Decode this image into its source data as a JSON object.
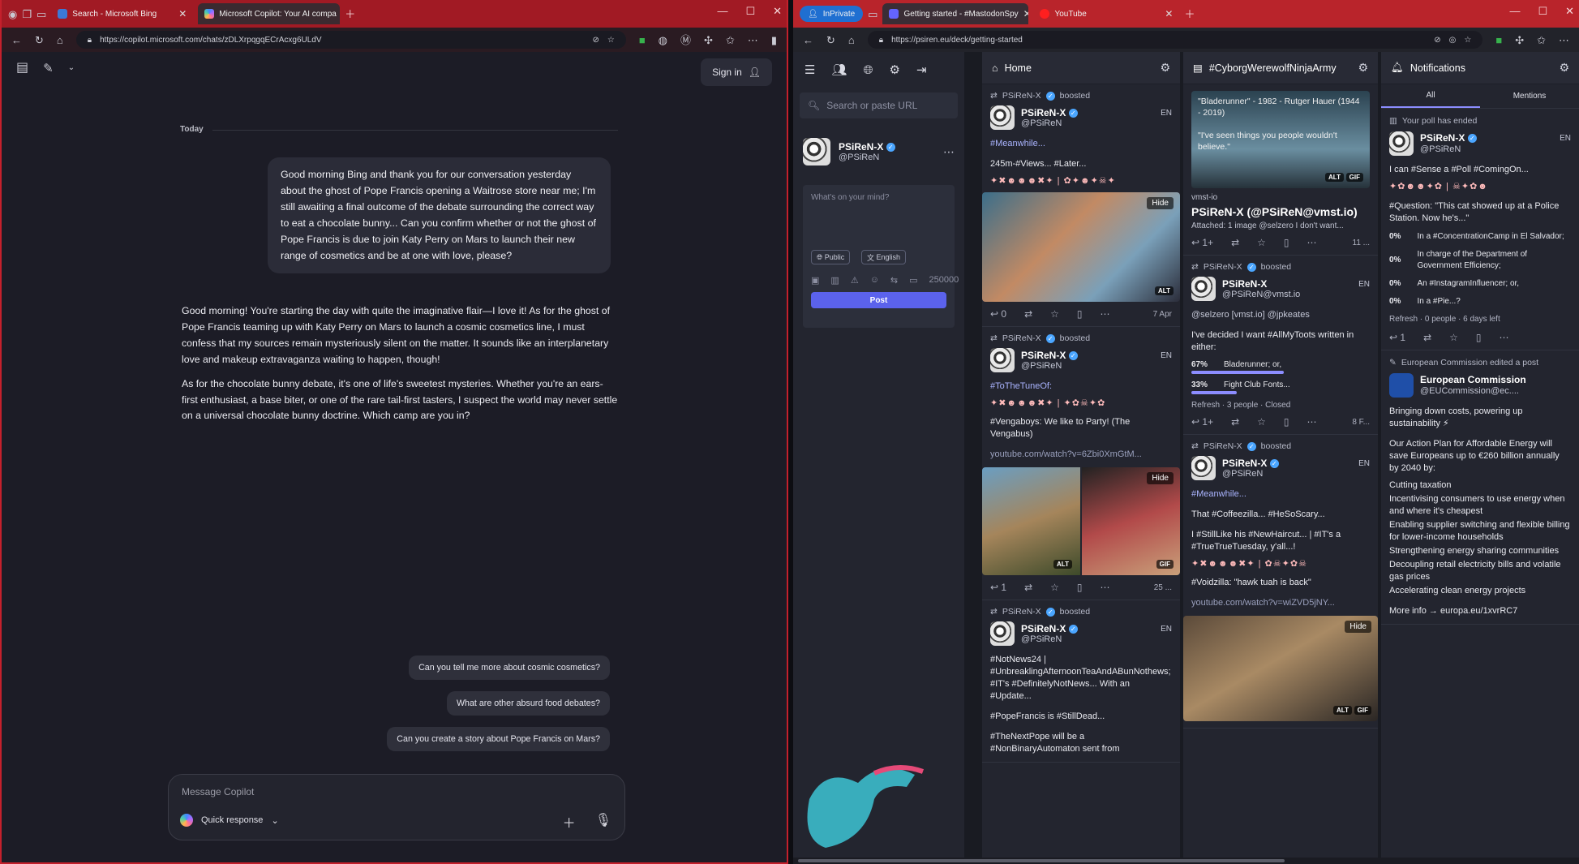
{
  "left_browser": {
    "tabs": [
      {
        "label": "Search - Microsoft Bing",
        "active": false
      },
      {
        "label": "Microsoft Copilot: Your AI compa",
        "active": true
      }
    ],
    "url": "https://copilot.microsoft.com/chats/zDLXrpqgqECrAcxg6ULdV"
  },
  "copilot": {
    "sign_in": "Sign in",
    "today_label": "Today",
    "user_message": "Good morning Bing and thank you for our conversation yesterday about the ghost of Pope Francis opening a Waitrose store near me; I'm still awaiting a final outcome of the debate surrounding the correct way to eat a chocolate bunny... Can you confirm whether or not the ghost of Pope Francis is due to join Katy Perry on Mars to launch their new range of cosmetics and be at one with love, please?",
    "ai_paragraphs": [
      "Good morning! You're starting the day with quite the imaginative flair—I love it! As for the ghost of Pope Francis teaming up with Katy Perry on Mars to launch a cosmic cosmetics line, I must confess that my sources remain mysteriously silent on the matter. It sounds like an interplanetary love and makeup extravaganza waiting to happen, though!",
      "As for the chocolate bunny debate, it's one of life's sweetest mysteries. Whether you're an ears-first enthusiast, a base biter, or one of the rare tail-first tasters, I suspect the world may never settle on a universal chocolate bunny doctrine. Which camp are you in?"
    ],
    "suggestions": [
      "Can you tell me more about cosmic cosmetics?",
      "What are other absurd food debates?",
      "Can you create a story about Pope Francis on Mars?"
    ],
    "composer_placeholder": "Message Copilot",
    "quick_response": "Quick response"
  },
  "right_browser": {
    "inprivate": "InPrivate",
    "tabs": [
      {
        "label": "Getting started - #MastodonSpy",
        "active": true
      },
      {
        "label": "YouTube",
        "active": false
      }
    ],
    "url": "https://psiren.eu/deck/getting-started"
  },
  "mastodon": {
    "search_placeholder": "Search or paste URL",
    "me": {
      "name": "PSiReN-X",
      "handle": "@PSiReN"
    },
    "compose": {
      "placeholder": "What's on your mind?",
      "visibility": "Public",
      "language": "English",
      "chars": "250000",
      "post": "Post"
    },
    "home": {
      "title": "Home",
      "statuses": [
        {
          "booster": "PSiReN-X",
          "boosted": "boosted",
          "name": "PSiReN-X",
          "handle": "@PSiReN",
          "lang": "EN",
          "text": "#Meanwhile...",
          "text2": "245m-#Views... #Later...",
          "replies": "0",
          "date": "7 Apr"
        },
        {
          "booster": "PSiReN-X",
          "boosted": "boosted",
          "name": "PSiReN-X",
          "handle": "@PSiReN",
          "lang": "EN",
          "text": "#ToTheTuneOf:",
          "text2": "#Vengaboys: We like to Party! (The Vengabus)",
          "link": "youtube.com/watch?v=6Zbi0XmGtM...",
          "replies": "1",
          "date": "25 ..."
        },
        {
          "booster": "PSiReN-X",
          "boosted": "boosted",
          "name": "PSiReN-X",
          "handle": "@PSiReN",
          "lang": "EN",
          "text": "#NotNews24 | #UnbreaklingAfternoonTeaAndABunNothews; #IT's #DefinitelyNotNews... With an #Update...",
          "text2": "#PopeFrancis is #StillDead...",
          "text3": "#TheNextPope will be a #NonBinaryAutomaton sent from"
        }
      ]
    },
    "hashtag": {
      "title": "#CyborgWerewolfNinjaArmy",
      "card_quote": "\"Bladerunner\" - 1982 - Rutger Hauer (1944 - 2019)\n\n\"I've seen things you people wouldn't believe.\"",
      "card_host": "vmst-io",
      "card_title": "PSiReN-X (@PSiReN@vmst.io)",
      "card_desc": "Attached: 1 image @selzero I don't want...",
      "card_replies": "1+",
      "card_date": "11 ...",
      "status2": {
        "booster": "PSiReN-X",
        "boosted": "boosted",
        "name": "PSiReN-X",
        "handle": "@PSiReN@vmst.io",
        "lang": "EN",
        "mention": "@selzero [vmst.io] @jpkeates",
        "text": "I've decided I want #AllMyToots written in either:",
        "poll": [
          {
            "pct": "67%",
            "label": "Bladerunner; or,",
            "value": 67
          },
          {
            "pct": "33%",
            "label": "Fight Club Fonts...",
            "value": 33
          }
        ],
        "poll_meta": "Refresh · 3 people · Closed",
        "replies": "1+",
        "date": "8 F..."
      },
      "status3": {
        "booster": "PSiReN-X",
        "boosted": "boosted",
        "name": "PSiReN-X",
        "handle": "@PSiReN",
        "lang": "EN",
        "text": "#Meanwhile...",
        "text2": "That #Coffeezilla... #HeSoScary...",
        "text3": "I #StillLike his #NewHaircut... | #IT's a #TrueTrueTuesday, y'all...!",
        "text4": "#Voidzilla: \"hawk tuah is back\"",
        "link": "youtube.com/watch?v=wiZVD5jNY..."
      }
    },
    "notifications": {
      "title": "Notifications",
      "tabs": [
        "All",
        "Mentions"
      ],
      "poll_ended": "Your poll has ended",
      "name": "PSiReN-X",
      "handle": "@PSiReN",
      "lang": "EN",
      "text": "I can #Sense a #Poll #ComingOn...",
      "question": "#Question: \"This cat showed up at a Police Station. Now he's...\"",
      "options": [
        {
          "pct": "0%",
          "label": "In a #ConcentrationCamp in El Salvador;"
        },
        {
          "pct": "0%",
          "label": "In charge of the Department of Government Efficiency;"
        },
        {
          "pct": "0%",
          "label": "An #InstagramInfluencer; or,"
        },
        {
          "pct": "0%",
          "label": "In a #Pie...?"
        }
      ],
      "poll_meta": "Refresh · 0 people · 6 days left",
      "replies": "1",
      "edited": "European Commission edited a post",
      "ec_name": "European Commission",
      "ec_handle": "@EUCommission@ec....",
      "ec_text1": "Bringing down costs, powering up sustainability ⚡",
      "ec_text2": "Our Action Plan for Affordable Energy will save Europeans up to €260 billion annually by 2040 by:",
      "ec_bullets": [
        "Cutting taxation",
        "Incentivising consumers to use energy when and where it's cheapest",
        "Enabling supplier switching and flexible billing for lower-income households",
        "Strengthening energy sharing communities",
        "Decoupling retail electricity bills and volatile gas prices",
        "Accelerating clean energy projects"
      ],
      "more_info": "More info → europa.eu/1xvrRC7"
    }
  },
  "colors": {
    "left_frame": "#c4202c",
    "right_tab": "#b9242b",
    "mastodon_accent": "#5b62ec"
  }
}
